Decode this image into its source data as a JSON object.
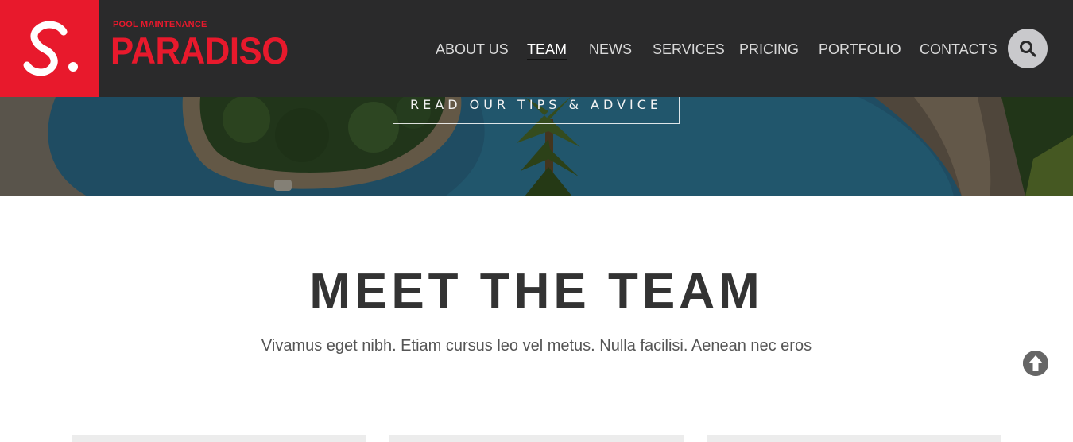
{
  "brand": {
    "tagline": "POOL MAINTENANCE",
    "name": "PARADISO",
    "logo_letter": "S.",
    "accent_color": "#e8192c"
  },
  "nav": {
    "items": [
      {
        "label": "ABOUT US",
        "active": false
      },
      {
        "label": "TEAM",
        "active": true
      },
      {
        "label": "NEWS",
        "active": false
      },
      {
        "label": "SERVICES",
        "active": false
      },
      {
        "label": "PRICING",
        "active": false
      },
      {
        "label": "PORTFOLIO",
        "active": false
      },
      {
        "label": "CONTACTS",
        "active": false
      }
    ],
    "search_icon": "search-icon"
  },
  "hero": {
    "button_label": "READ OUR TIPS & ADVICE"
  },
  "team": {
    "title": "MEET THE TEAM",
    "subtitle": "Vivamus eget nibh. Etiam cursus leo vel metus. Nulla facilisi. Aenean nec eros"
  },
  "scroll_top_icon": "arrow-up-circle-icon"
}
